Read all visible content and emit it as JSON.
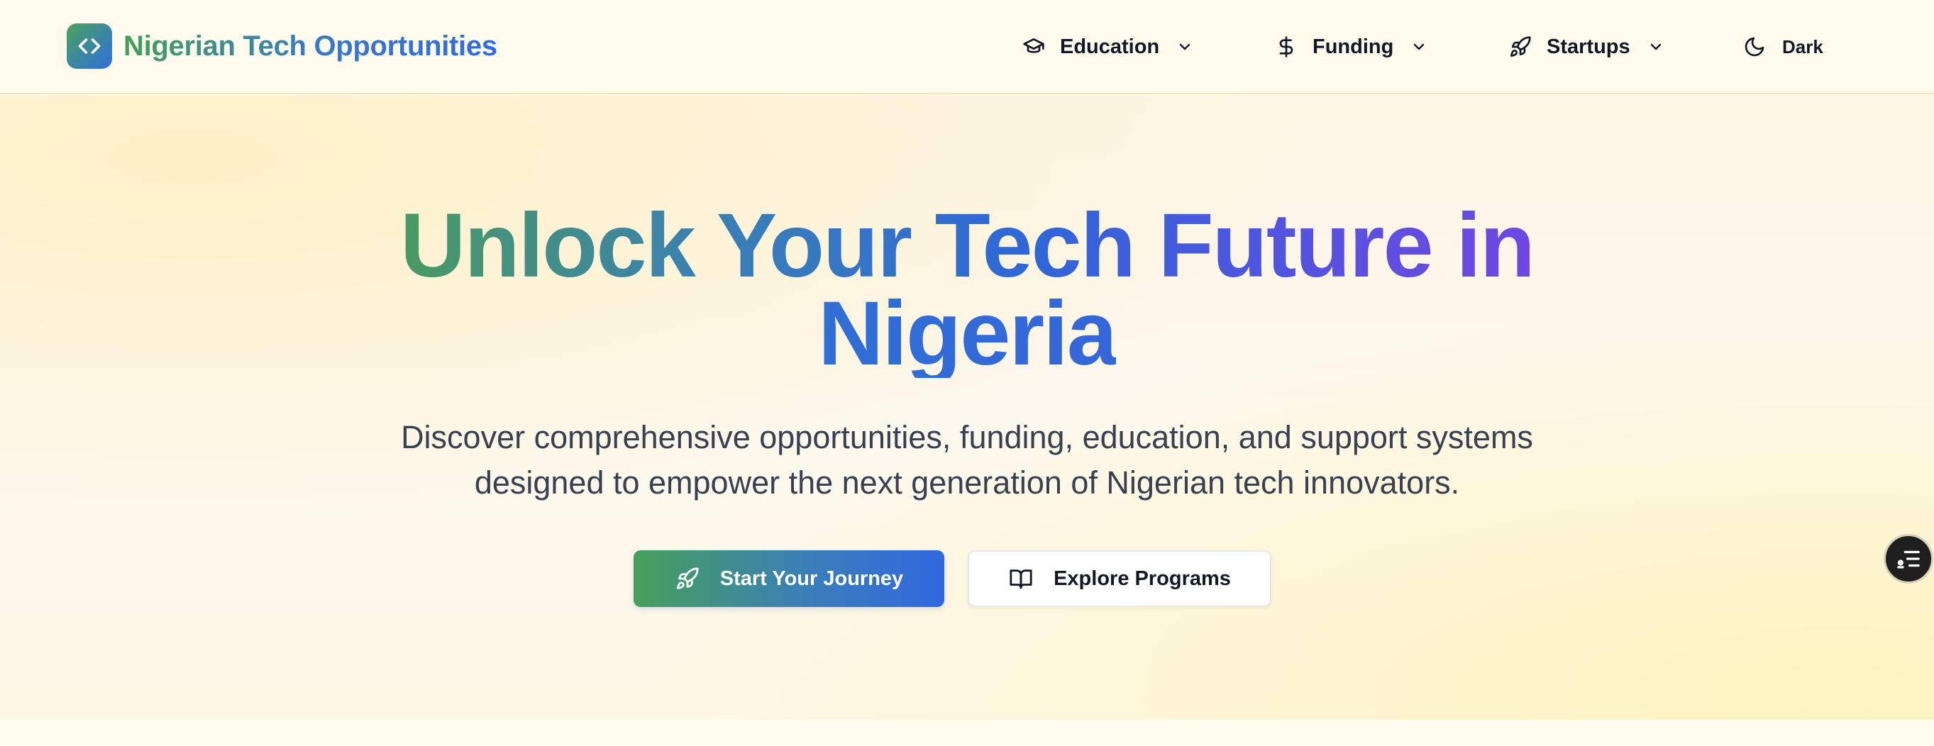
{
  "header": {
    "brand_name": "Nigerian Tech Opportunities",
    "logo_icon": "code-icon",
    "nav": [
      {
        "label": "Education",
        "icon": "graduation-cap-icon"
      },
      {
        "label": "Funding",
        "icon": "dollar-icon"
      },
      {
        "label": "Startups",
        "icon": "rocket-icon"
      }
    ],
    "theme_toggle": {
      "label": "Dark",
      "icon": "moon-icon"
    }
  },
  "hero": {
    "title_line1": "Unlock Your Tech Future in",
    "title_line2": "Nigeria",
    "subtitle_line1": "Discover comprehensive opportunities, funding, education, and support systems",
    "subtitle_line2": "designed to empower the next generation of Nigerian tech innovators.",
    "primary_cta": {
      "label": "Start Your Journey",
      "icon": "rocket-icon"
    },
    "secondary_cta": {
      "label": "Explore Programs",
      "icon": "book-open-icon"
    }
  },
  "floating_widget": {
    "icon": "chat-list-icon"
  },
  "colors": {
    "brand_green": "#45a05a",
    "brand_blue": "#2f68e0",
    "accent_purple": "#7047e2",
    "background": "#fdf8ee"
  }
}
